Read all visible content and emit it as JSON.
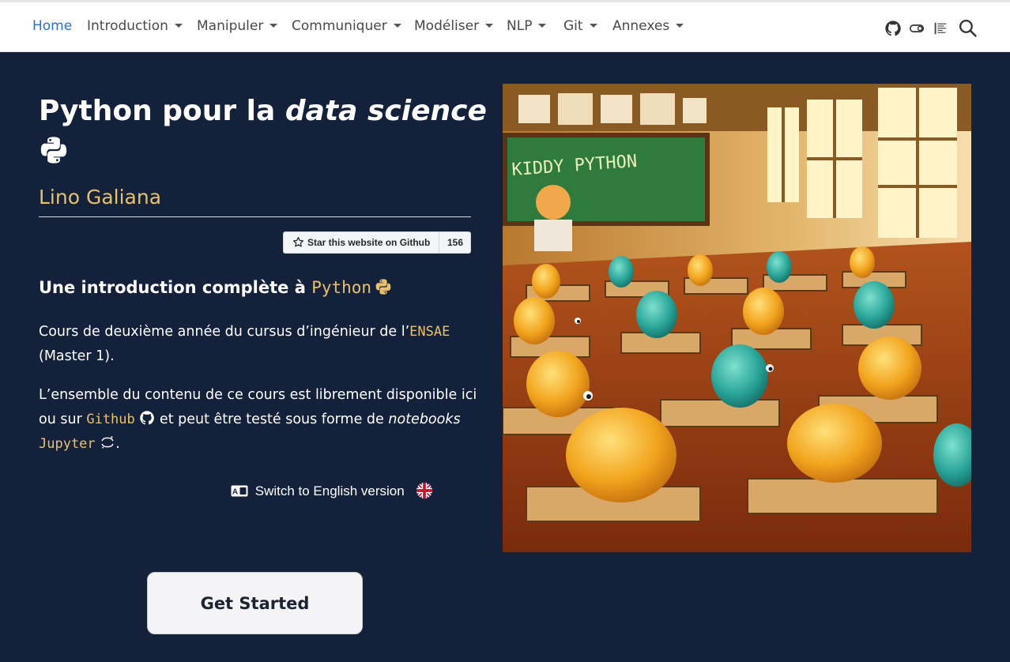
{
  "nav": {
    "items": [
      {
        "label": "Home",
        "active": true,
        "dropdown": false
      },
      {
        "label": "Introduction",
        "active": false,
        "dropdown": true
      },
      {
        "label": "Manipuler",
        "active": false,
        "dropdown": true
      },
      {
        "label": "Communiquer",
        "active": false,
        "dropdown": true
      },
      {
        "label": "Modéliser",
        "active": false,
        "dropdown": true
      },
      {
        "label": "NLP",
        "active": false,
        "dropdown": true
      },
      {
        "label": "Git",
        "active": false,
        "dropdown": true
      },
      {
        "label": "Annexes",
        "active": false,
        "dropdown": true
      }
    ],
    "icons": [
      "github-icon",
      "toggle-icon",
      "reader-icon",
      "search-icon"
    ]
  },
  "hero": {
    "title_plain": "Python pour la",
    "title_emph": "data science",
    "author": "Lino Galiana",
    "github_star": {
      "label": "Star this website on Github",
      "count": "156"
    },
    "subtitle_text": "Une introduction complète à",
    "subtitle_code": "Python",
    "para1": {
      "before": "Cours de deuxième année du cursus d’ingénieur de l’",
      "code": "ENSAE",
      "after": "(Master 1)."
    },
    "para2": {
      "line1": "L’ensemble du contenu de ce cours est librement disponible ici",
      "pre": "ou sur",
      "code1": "Github",
      "mid": "et peut être testé sous forme de",
      "emph": "notebooks",
      "code2": "Jupyter",
      "end": "."
    },
    "switch_lang": "Switch to English version",
    "cta": "Get Started",
    "image_text": "KIDDY PYTHON"
  },
  "colors": {
    "background": "#14213a",
    "accent": "#e7c16e",
    "nav_active": "#2d6ed0"
  }
}
